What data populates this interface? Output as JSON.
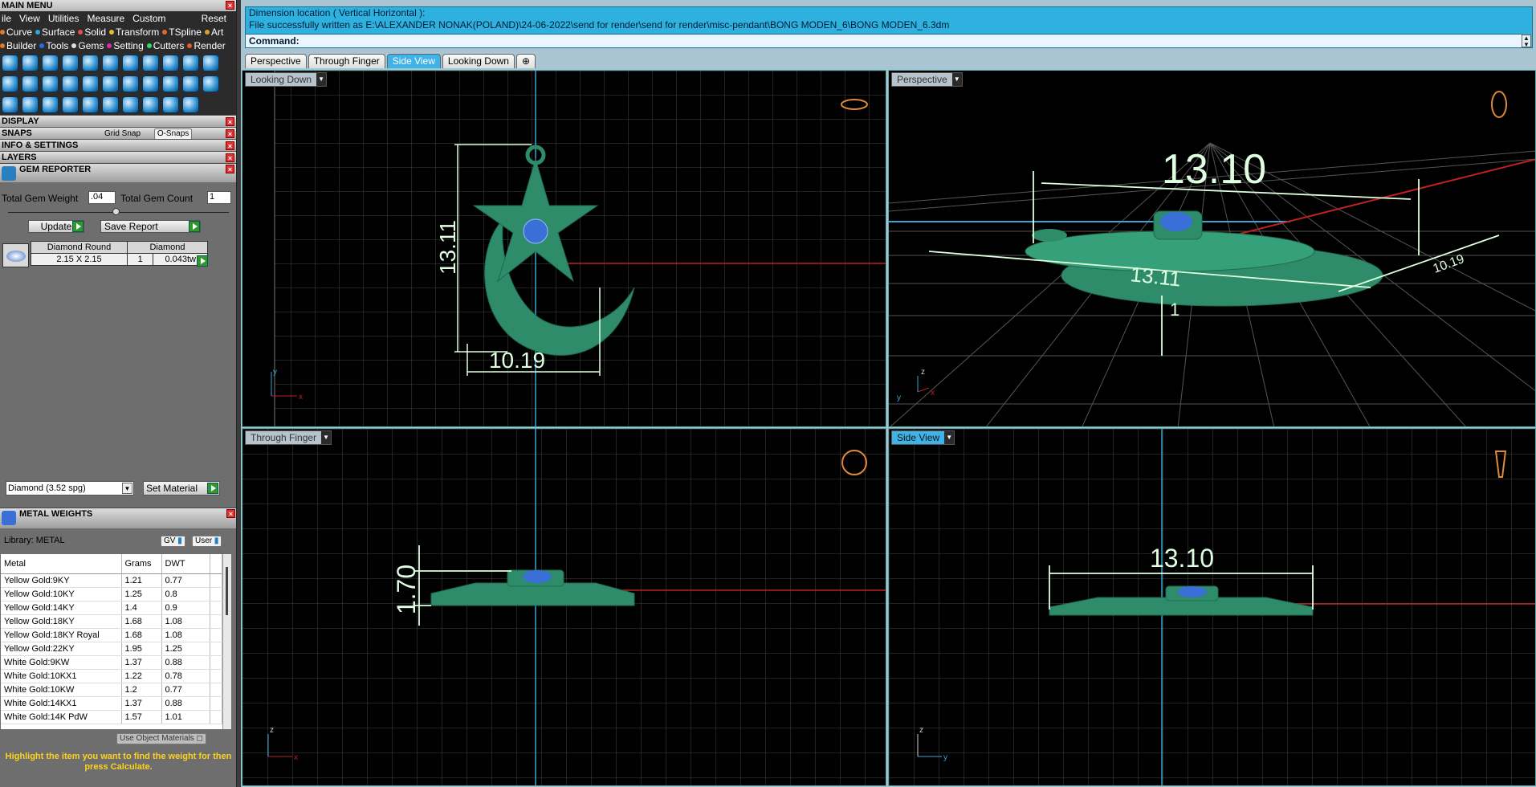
{
  "left_panel": {
    "main_menu_title": "MAIN MENU",
    "menu": [
      "ile",
      "View",
      "Utilities",
      "Measure",
      "Custom"
    ],
    "reset": "Reset",
    "categories_row1": [
      {
        "label": "Curve",
        "color": "#e07a2a"
      },
      {
        "label": "Surface",
        "color": "#2aa6e0"
      },
      {
        "label": "Solid",
        "color": "#e05050"
      },
      {
        "label": "Transform",
        "color": "#e0c02a"
      },
      {
        "label": "TSpline",
        "color": "#e06a2a"
      },
      {
        "label": "Art",
        "color": "#e0a02a"
      }
    ],
    "categories_row2": [
      {
        "label": "Builder",
        "color": "#e07a2a"
      },
      {
        "label": "Tools",
        "color": "#2a6ae0"
      },
      {
        "label": "Gems",
        "color": "#e0e0e0"
      },
      {
        "label": "Setting",
        "color": "#e02aa6"
      },
      {
        "label": "Cutters",
        "color": "#2ae06a"
      },
      {
        "label": "Render",
        "color": "#e0602a"
      }
    ],
    "sections": {
      "display": "DISPLAY",
      "snaps": "SNAPS",
      "grid_snap": "Grid Snap",
      "osnaps": "O-Snaps",
      "info_settings": "INFO & SETTINGS",
      "layers": "LAYERS"
    },
    "gem_reporter": {
      "title": "GEM REPORTER",
      "total_weight_label": "Total Gem Weight",
      "total_weight_value": ".04",
      "total_count_label": "Total Gem Count",
      "total_count_value": "1",
      "update": "Update",
      "save_report": "Save Report",
      "columns": [
        "Diamond Round",
        "Diamond"
      ],
      "row": {
        "size": "2.15 X 2.15",
        "count": "1",
        "weight": "0.043tw"
      },
      "material_select": "Diamond    (3.52 spg)",
      "set_material": "Set Material"
    },
    "metal_weights": {
      "title": "METAL WEIGHTS",
      "library": "Library: METAL",
      "gv": "GV",
      "user": "User",
      "headers": [
        "Metal",
        "Grams",
        "DWT"
      ],
      "rows": [
        [
          "Yellow Gold:9KY",
          "1.21",
          "0.77"
        ],
        [
          "Yellow Gold:10KY",
          "1.25",
          "0.8"
        ],
        [
          "Yellow Gold:14KY",
          "1.4",
          "0.9"
        ],
        [
          "Yellow Gold:18KY",
          "1.68",
          "1.08"
        ],
        [
          "Yellow Gold:18KY Royal",
          "1.68",
          "1.08"
        ],
        [
          "Yellow Gold:22KY",
          "1.95",
          "1.25"
        ],
        [
          "White Gold:9KW",
          "1.37",
          "0.88"
        ],
        [
          "White Gold:10KX1",
          "1.22",
          "0.78"
        ],
        [
          "White Gold:10KW",
          "1.2",
          "0.77"
        ],
        [
          "White Gold:14KX1",
          "1.37",
          "0.88"
        ],
        [
          "White Gold:14K PdW",
          "1.57",
          "1.01"
        ]
      ],
      "use_object_materials": "Use Object Materials",
      "hint": "Highlight the item you want to find the weight for then press Calculate."
    }
  },
  "command": {
    "line1": "Dimension location ( Vertical  Horizontal ):",
    "line2": "File successfully written as E:\\ALEXANDER NONAK(POLAND)\\24-06-2022\\send for render\\send for render\\misc-pendant\\BONG MODEN_6\\BONG MODEN_6.3dm",
    "prompt": "Command:"
  },
  "tabs": [
    "Perspective",
    "Through Finger",
    "Side View",
    "Looking Down"
  ],
  "active_tab": "Side View",
  "viewports": {
    "top_left": {
      "label": "Looking Down",
      "dim_h": "10.19",
      "dim_v": "13.11"
    },
    "top_right": {
      "label": "Perspective",
      "dim_main": "13.10",
      "dim_mid": "13.11",
      "dim_side": "10.19",
      "dim_small": "1"
    },
    "bottom_left": {
      "label": "Through Finger",
      "dim_v": "1.70"
    },
    "bottom_right": {
      "label": "Side View",
      "dim_h": "13.10"
    }
  },
  "colors": {
    "model": "#2e8c6a",
    "gem": "#3a6fd8",
    "dimension": "#dfffe0",
    "grid": "#4a4a4a",
    "x_axis": "#c02020"
  }
}
